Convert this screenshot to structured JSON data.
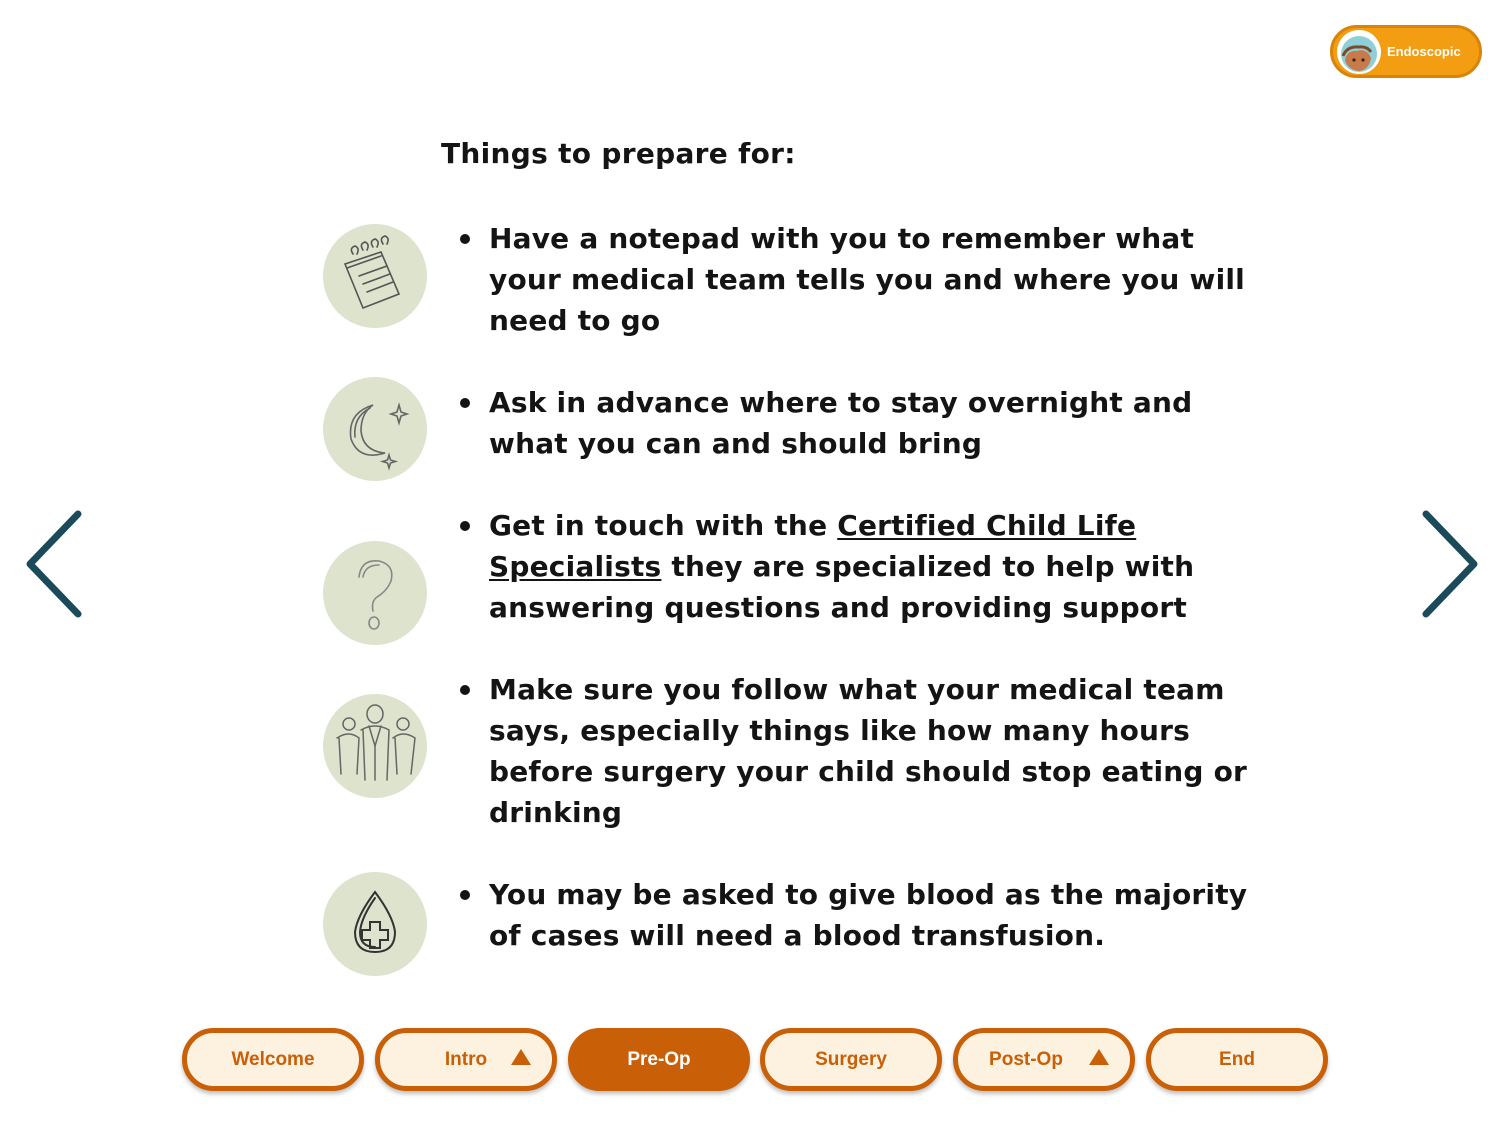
{
  "badge": {
    "label": "Endoscopic"
  },
  "heading": "Things to prepare for:",
  "items": [
    {
      "icon": "notepad-icon",
      "text": "Have a notepad with you to remember what your medical team tells you and where you will need to go"
    },
    {
      "icon": "moon-stars-icon",
      "text": "Ask in advance where to stay overnight and what you can and should bring"
    },
    {
      "icon": "question-mark-icon",
      "text_before": "Get in touch with the ",
      "link": "Certified Child Life Specialists",
      "text_after": " they are specialized to help with answering questions and providing support"
    },
    {
      "icon": "medical-team-icon",
      "text": "Make sure you follow what your medical team says, especially things like how many hours before surgery your child should stop eating or drinking"
    },
    {
      "icon": "blood-drop-icon",
      "text": "You may be asked to give blood as the majority of cases will need a blood transfusion."
    }
  ],
  "nav": {
    "tabs": [
      {
        "label": "Welcome",
        "active": false,
        "submenu": false
      },
      {
        "label": "Intro",
        "active": false,
        "submenu": true
      },
      {
        "label": "Pre-Op",
        "active": true,
        "submenu": false
      },
      {
        "label": "Surgery",
        "active": false,
        "submenu": false
      },
      {
        "label": "Post-Op",
        "active": false,
        "submenu": true
      },
      {
        "label": "End",
        "active": false,
        "submenu": false
      }
    ]
  },
  "colors": {
    "accent": "#c95f07",
    "badge": "#f29d12",
    "icon_bg": "#dde3cc",
    "arrow": "#1b4a5a",
    "tab_bg": "#fdf1df"
  }
}
